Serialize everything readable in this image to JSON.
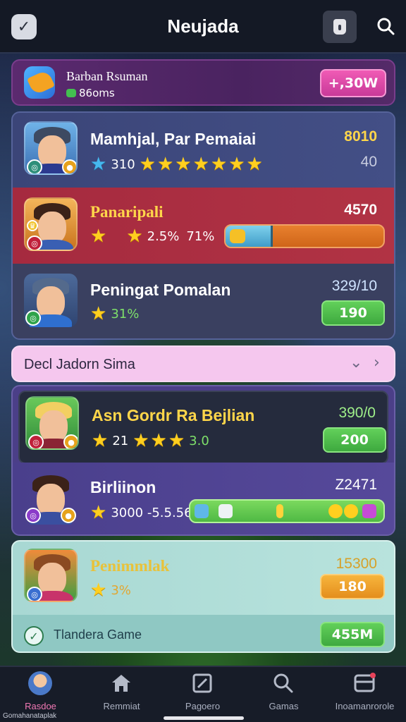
{
  "app": {
    "title": "Neujada"
  },
  "promo": {
    "name": "Barban Rsuman",
    "sub": "86oms",
    "button": "+,30W"
  },
  "players": [
    {
      "name": "Mamhjal, Par Pemaiai",
      "stars_text": "310",
      "score": "8010",
      "sub_score": "40"
    },
    {
      "name": "Panaripali",
      "stars_text": "2.5%",
      "stars_text2": "71%",
      "score": "4570",
      "progress": 0.3
    },
    {
      "name": "Peningat Pomalan",
      "stars_text": "31%",
      "score": "329/10",
      "button": "190"
    }
  ],
  "divider": {
    "label": "Decl Jadorn Sima"
  },
  "players2": [
    {
      "name": "Asn Gordr Ra Bejlian",
      "stars_text": "21",
      "stars_text2": "3.0",
      "score": "390/0",
      "button": "200"
    },
    {
      "name": "Birliinon",
      "stars_text": "3000 -5.5.56",
      "score": "Z2471"
    }
  ],
  "players3": [
    {
      "name": "Penimmlak",
      "stars_text": "3%",
      "score": "15300",
      "button": "180"
    }
  ],
  "footer_row": {
    "label": "Tlandera Game",
    "button": "455M"
  },
  "nav": [
    {
      "label": "Rasdoe",
      "icon": "avatar-icon",
      "active": true
    },
    {
      "label": "Remmiat",
      "icon": "home-icon"
    },
    {
      "label": "Pagoero",
      "icon": "edit-icon"
    },
    {
      "label": "Gamas",
      "icon": "search-icon"
    },
    {
      "label": "Inoamanrorole",
      "icon": "inbox-icon"
    }
  ],
  "caption": "Gomahanataplak",
  "colors": {
    "accent_pink": "#f178b4",
    "green": "#4fb944",
    "orange": "#e48e1d",
    "gold": "#ffcf1f"
  }
}
